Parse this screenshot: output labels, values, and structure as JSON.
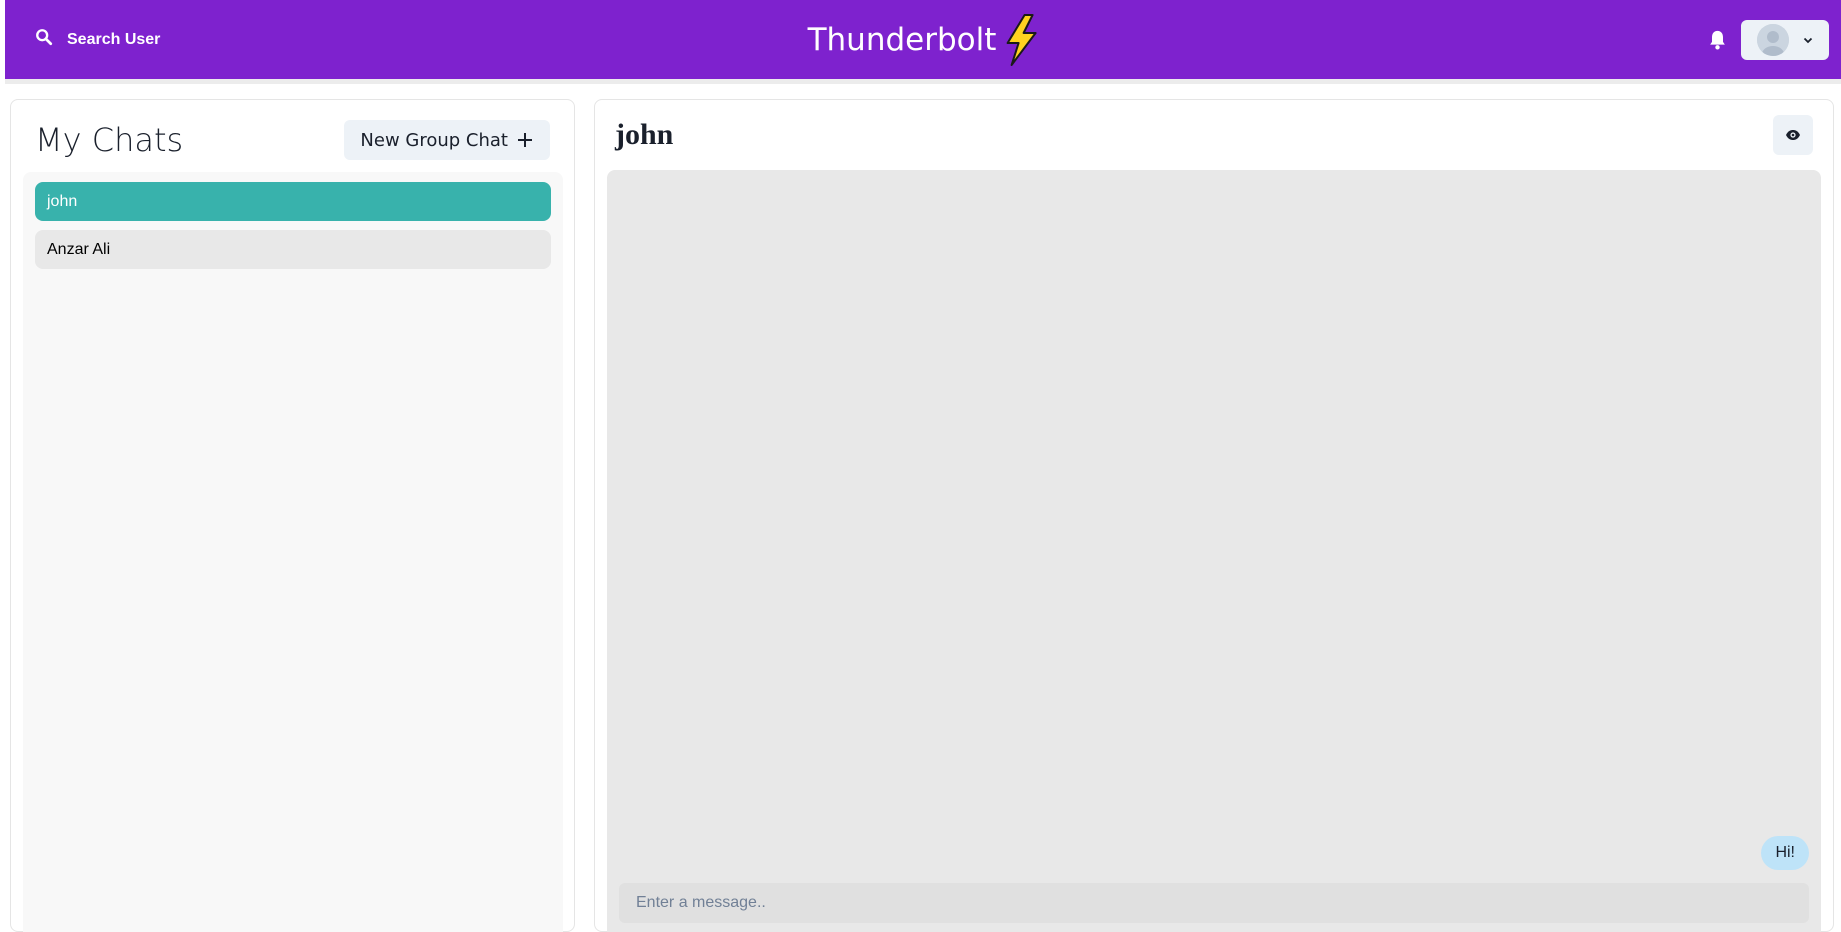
{
  "header": {
    "search_label": "Search User",
    "brand_title": "Thunderbolt",
    "brand_icon": "lightning-bolt-icon",
    "accent_color": "#7e22ce"
  },
  "sidebar": {
    "title": "My Chats",
    "new_group_label": "New Group Chat",
    "chats": [
      {
        "name": "john",
        "active": true
      },
      {
        "name": "Anzar Ali",
        "active": false
      }
    ],
    "active_color": "#38b2ac"
  },
  "conversation": {
    "title": "john",
    "messages": [
      {
        "text": "Hi!",
        "from_self": true
      }
    ],
    "input_placeholder": "Enter a message..",
    "input_value": ""
  }
}
